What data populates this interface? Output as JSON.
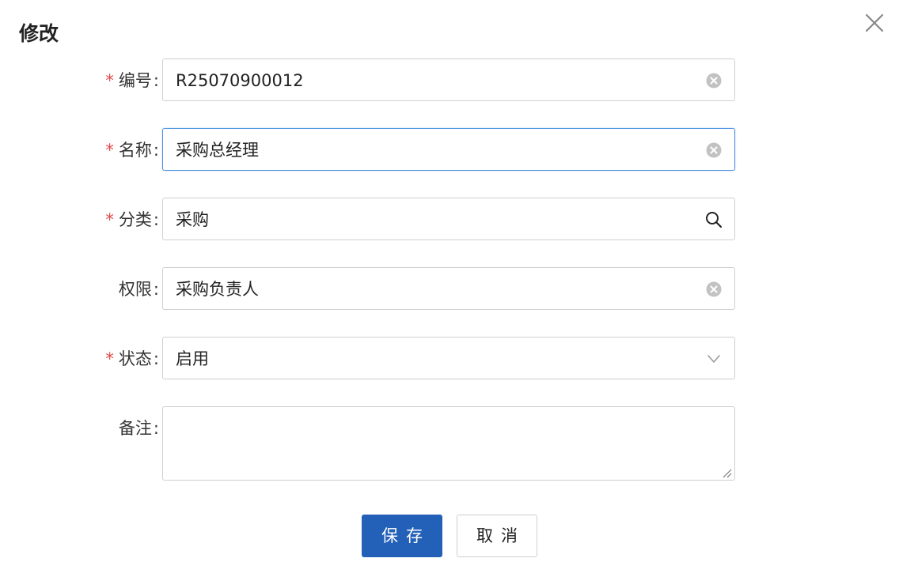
{
  "dialog": {
    "title": "修改",
    "close_icon": "close-icon"
  },
  "form": {
    "required_mark": "*",
    "colon": ":",
    "code": {
      "label": "编号",
      "value": "R25070900012",
      "suffix_icon": "clear-icon"
    },
    "name": {
      "label": "名称",
      "value": "采购总经理",
      "suffix_icon": "clear-icon"
    },
    "category": {
      "label": "分类",
      "value": "采购",
      "suffix_icon": "search-icon"
    },
    "permission": {
      "label": "权限",
      "value": "采购负责人",
      "suffix_icon": "clear-icon"
    },
    "status": {
      "label": "状态",
      "value": "启用",
      "suffix_icon": "chevron-down-icon"
    },
    "remark": {
      "label": "备注",
      "value": ""
    }
  },
  "actions": {
    "save_label": "保存",
    "cancel_label": "取消"
  },
  "colors": {
    "primary": "#2360b8",
    "required": "#e04848",
    "focus_border": "#4a90e2",
    "border": "#cfcfcf"
  }
}
